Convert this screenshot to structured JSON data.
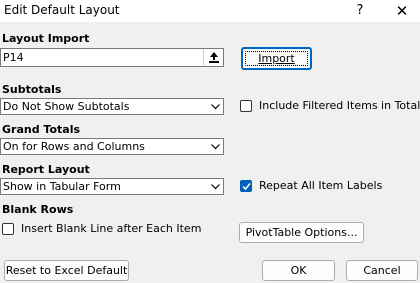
{
  "window": {
    "title": "Edit Default Layout",
    "help_label": "?",
    "close_label": "✕"
  },
  "layout_import": {
    "label": "Layout Import",
    "field_value": "P14",
    "collapse_icon": "upload-arrow-icon",
    "import_button": "Import"
  },
  "subtotals": {
    "label": "Subtotals",
    "selected": "Do Not Show Subtotals",
    "include_filtered_label": "Include Filtered Items in Totals",
    "include_filtered_checked": false
  },
  "grand_totals": {
    "label": "Grand Totals",
    "selected": "On for Rows and Columns"
  },
  "report_layout": {
    "label": "Report Layout",
    "selected": "Show in Tabular Form",
    "repeat_labels_label": "Repeat All Item Labels",
    "repeat_labels_checked": true
  },
  "blank_rows": {
    "label": "Blank Rows",
    "insert_blank_label": "Insert Blank Line after Each Item",
    "insert_blank_checked": false,
    "pivottable_options_button": "PivotTable Options..."
  },
  "footer": {
    "reset_button": "Reset to Excel Default",
    "ok_button": "OK",
    "cancel_button": "Cancel"
  },
  "colors": {
    "accent": "#005fb8",
    "dialog_bg": "#f0f0f0"
  }
}
